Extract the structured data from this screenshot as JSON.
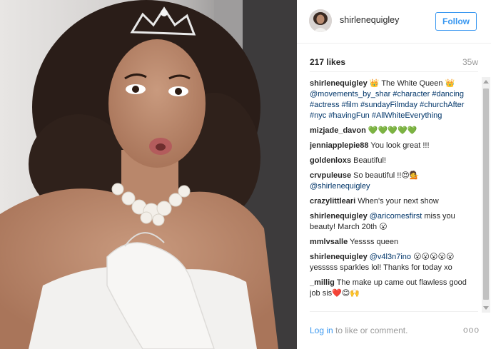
{
  "post": {
    "username": "shirlenequigley",
    "follow_label": "Follow",
    "likes": "217 likes",
    "age": "35w"
  },
  "comments": [
    {
      "user": "shirlenequigley",
      "parts": [
        " 👑 The White Queen 👑 ",
        "@movements_by_shar",
        " ",
        "#character",
        " ",
        "#dancing",
        " ",
        "#actress",
        " ",
        "#film",
        " ",
        "#sundayFilmday",
        " ",
        "#churchAfter",
        " ",
        "#nyc",
        " ",
        "#havingFun",
        " ",
        "#AllWhiteEverything"
      ]
    },
    {
      "user": "mizjade_davon",
      "parts": [
        " 💚💚💚💚💚"
      ]
    },
    {
      "user": "jenniapplepie88",
      "parts": [
        " You look great !!!"
      ]
    },
    {
      "user": "goldenloxs",
      "parts": [
        " Beautiful!"
      ]
    },
    {
      "user": "crvpuleuse",
      "parts": [
        " So beautiful !!😍💁 ",
        "@shirlenequigley"
      ]
    },
    {
      "user": "crazylittleari",
      "parts": [
        " When's your next show"
      ]
    },
    {
      "user": "shirlenequigley",
      "parts": [
        " ",
        "@aricomesfirst",
        " miss you beauty! March 20th 😮"
      ]
    },
    {
      "user": "mmlvsalle",
      "parts": [
        " Yessss queen"
      ]
    },
    {
      "user": "shirlenequigley",
      "parts": [
        " ",
        "@v4l3n7ino",
        " 😮😮😮😮😮 yesssss sparkles lol! Thanks for today xo"
      ]
    },
    {
      "user": "_millig",
      "parts": [
        " The make up came out flawless good job sis❤️😊🙌"
      ]
    }
  ],
  "footer": {
    "login_link": "Log in",
    "login_rest": " to like or comment.",
    "more_icon": "ellipsis-icon",
    "more": "ooo"
  },
  "colors": {
    "accent": "#3897f0",
    "hashtag": "#003569",
    "muted": "#999999"
  }
}
